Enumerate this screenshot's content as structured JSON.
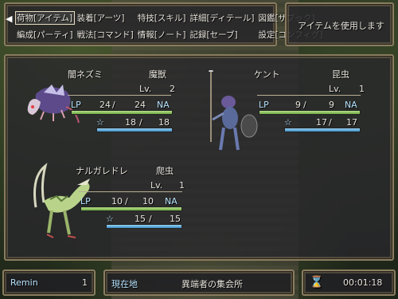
{
  "menu": {
    "items": [
      "荷物[アイテム]",
      "装着[アーツ]",
      "特技[スキル]",
      "詳細[ディテール]",
      "図鑑[ザブック]",
      "編成[パーティ]",
      "戦法[コマンド]",
      "情報[ノート]",
      "記録[セーブ]",
      "設定[コンフィグ]"
    ],
    "selected_index": 0
  },
  "help": {
    "text": "アイテムを使用します"
  },
  "party": [
    {
      "name": "闇ネズミ",
      "type": "魔獣",
      "lv_label": "Lv.",
      "lv": "2",
      "lp_label": "LP",
      "lp": "24",
      "lp_max": "24",
      "na": "NA",
      "mp_label": "☆",
      "mp": "18",
      "mp_max": "18",
      "lp_ratio": 1.0,
      "mp_ratio": 1.0
    },
    {
      "name": "ケント",
      "type": "昆虫",
      "lv_label": "Lv.",
      "lv": "1",
      "lp_label": "LP",
      "lp": "9",
      "lp_max": "9",
      "na": "NA",
      "mp_label": "☆",
      "mp": "17",
      "mp_max": "17",
      "lp_ratio": 1.0,
      "mp_ratio": 1.0
    },
    {
      "name": "ナルガレドレ",
      "type": "爬虫",
      "lv_label": "Lv.",
      "lv": "1",
      "lp_label": "LP",
      "lp": "10",
      "lp_max": "10",
      "na": "NA",
      "mp_label": "☆",
      "mp": "15",
      "mp_max": "15",
      "lp_ratio": 1.0,
      "mp_ratio": 1.0
    }
  ],
  "status": {
    "remin_label": "Remin",
    "remin_value": "1",
    "location_label": "現在地",
    "location": "異端者の集会所",
    "time": "00:01:18"
  },
  "colors": {
    "frame": "#8a7d60",
    "hp_bar": "#8cc45a",
    "mp_bar": "#5aaee0"
  }
}
